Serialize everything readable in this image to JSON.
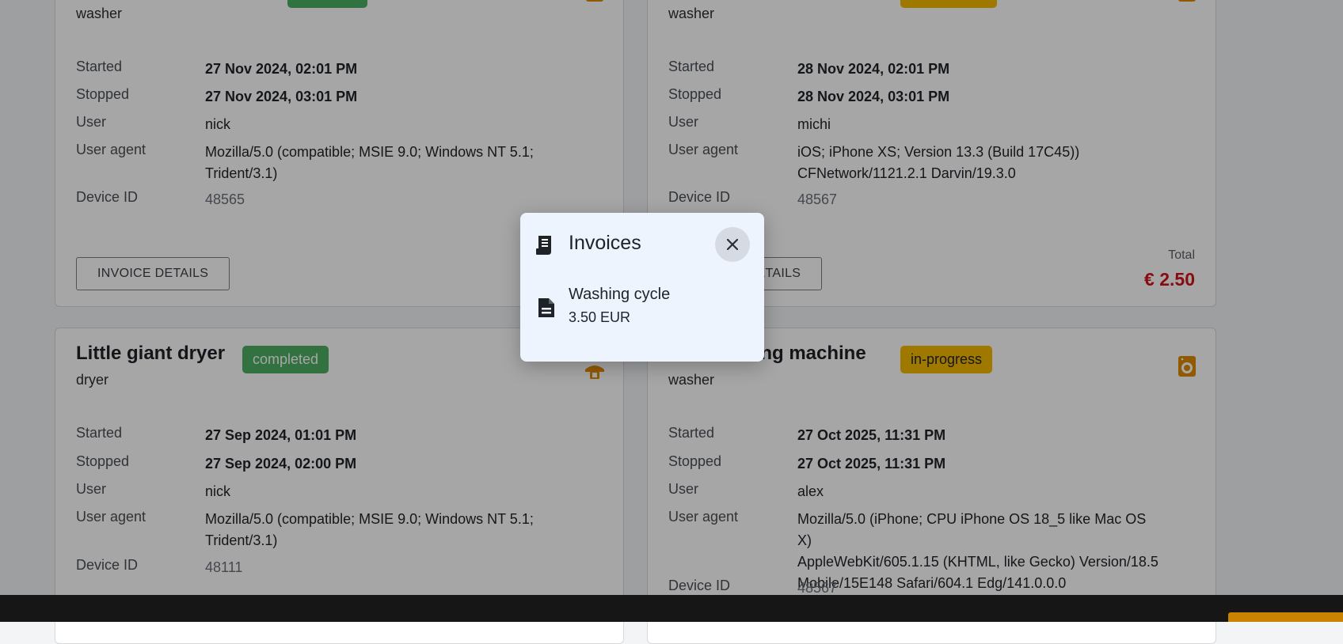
{
  "cards": [
    {
      "type": "washer",
      "badge": "",
      "rows": {
        "started_label": "Started",
        "started": "27 Nov 2024, 02:01 PM",
        "stopped_label": "Stopped",
        "stopped": "27 Nov 2024, 03:01 PM",
        "user_label": "User",
        "user": "nick",
        "ua_label": "User agent",
        "ua1": "Mozilla/5.0 (compatible; MSIE 9.0; Windows NT 5.1;",
        "ua2": "Trident/3.1)",
        "device_label": "Device ID",
        "device": "48565"
      },
      "button": "INVOICE DETAILS"
    },
    {
      "type": "washer",
      "badge": "",
      "rows": {
        "started_label": "Started",
        "started": "28 Nov 2024, 02:01 PM",
        "stopped_label": "Stopped",
        "stopped": "28 Nov 2024, 03:01 PM",
        "user_label": "User",
        "user": "michi",
        "ua_label": "User agent",
        "ua1": "iOS; iPhone XS; Version 13.3 (Build 17C45))",
        "ua2": "CFNetwork/1121.2.1 Darvin/19.3.0",
        "device_label": "Device ID",
        "device": "48567"
      },
      "button": "INVOICE DETAILS",
      "total_label": "Total",
      "total": "€ 2.50"
    },
    {
      "title": "Little giant dryer",
      "type": "dryer",
      "badge": "completed",
      "rows": {
        "started_label": "Started",
        "started": "27 Sep 2024, 01:01 PM",
        "stopped_label": "Stopped",
        "stopped": "27 Sep 2024, 02:00 PM",
        "user_label": "User",
        "user": "nick",
        "ua_label": "User agent",
        "ua1": "Mozilla/5.0 (compatible; MSIE 9.0; Windows NT 5.1;",
        "ua2": "Trident/3.1)",
        "device_label": "Device ID",
        "device": "48111"
      }
    },
    {
      "title": "hing machine",
      "type": "washer",
      "badge": "in-progress",
      "rows": {
        "started_label": "Started",
        "started": "27 Oct 2025, 11:31 PM",
        "stopped_label": "Stopped",
        "stopped": "27 Oct 2025, 11:31 PM",
        "user_label": "User",
        "user": "alex",
        "ua_label": "User agent",
        "ua1": "Mozilla/5.0 (iPhone; CPU iPhone OS 18_5 like Mac OS X)",
        "ua2": "AppleWebKit/605.1.15 (KHTML, like Gecko) Version/18.5",
        "ua3": "Mobile/15E148 Safari/604.1 Edg/141.0.0.0",
        "device_label": "Device ID",
        "device": "48567"
      }
    }
  ],
  "dialog": {
    "title": "Invoices",
    "title_icon": "receipt-icon",
    "close_icon": "close-icon",
    "item": {
      "title": "Washing cycle",
      "amount": "3.50 EUR",
      "icon": "invoice-document-icon"
    }
  },
  "colors": {
    "completed": "#4caf63",
    "in_progress": "#f5b800",
    "total": "#d3121a",
    "icon_orange": "#e08a00",
    "dialog_bg": "#eef4fe"
  }
}
